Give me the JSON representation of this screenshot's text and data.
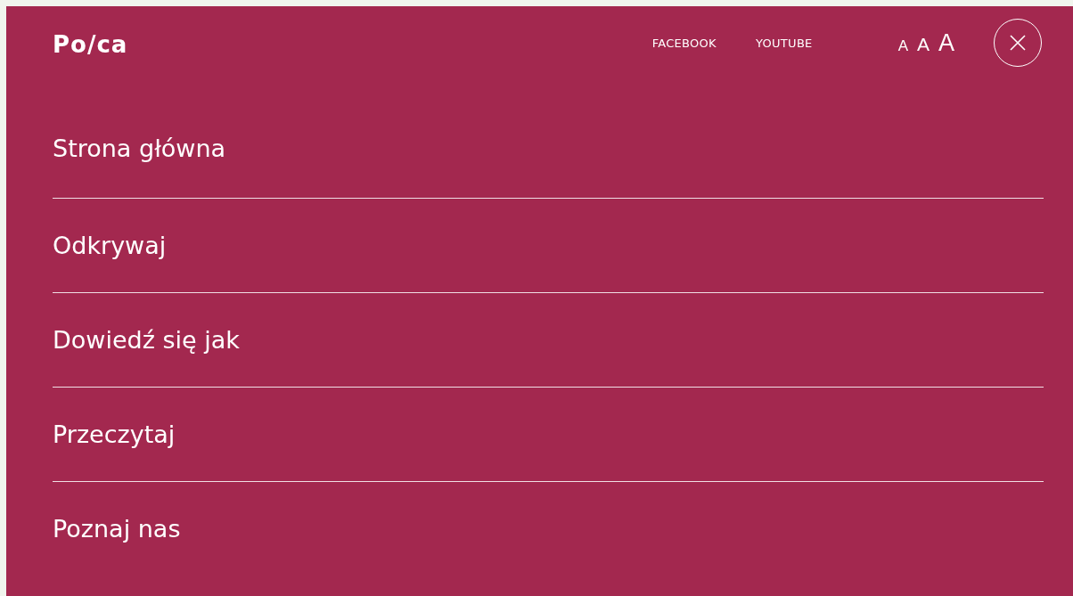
{
  "logo": "Po/ca",
  "header_links": [
    "FACEBOOK",
    "YOUTUBE"
  ],
  "font_size_buttons": [
    {
      "label": "A",
      "kind": "small"
    },
    {
      "label": "A",
      "kind": "medium"
    },
    {
      "label": "A",
      "kind": "large"
    }
  ],
  "menu_items": [
    "Strona główna",
    "Odkrywaj",
    "Dowiedź się jak",
    "Przeczytaj",
    "Poznaj nas"
  ]
}
